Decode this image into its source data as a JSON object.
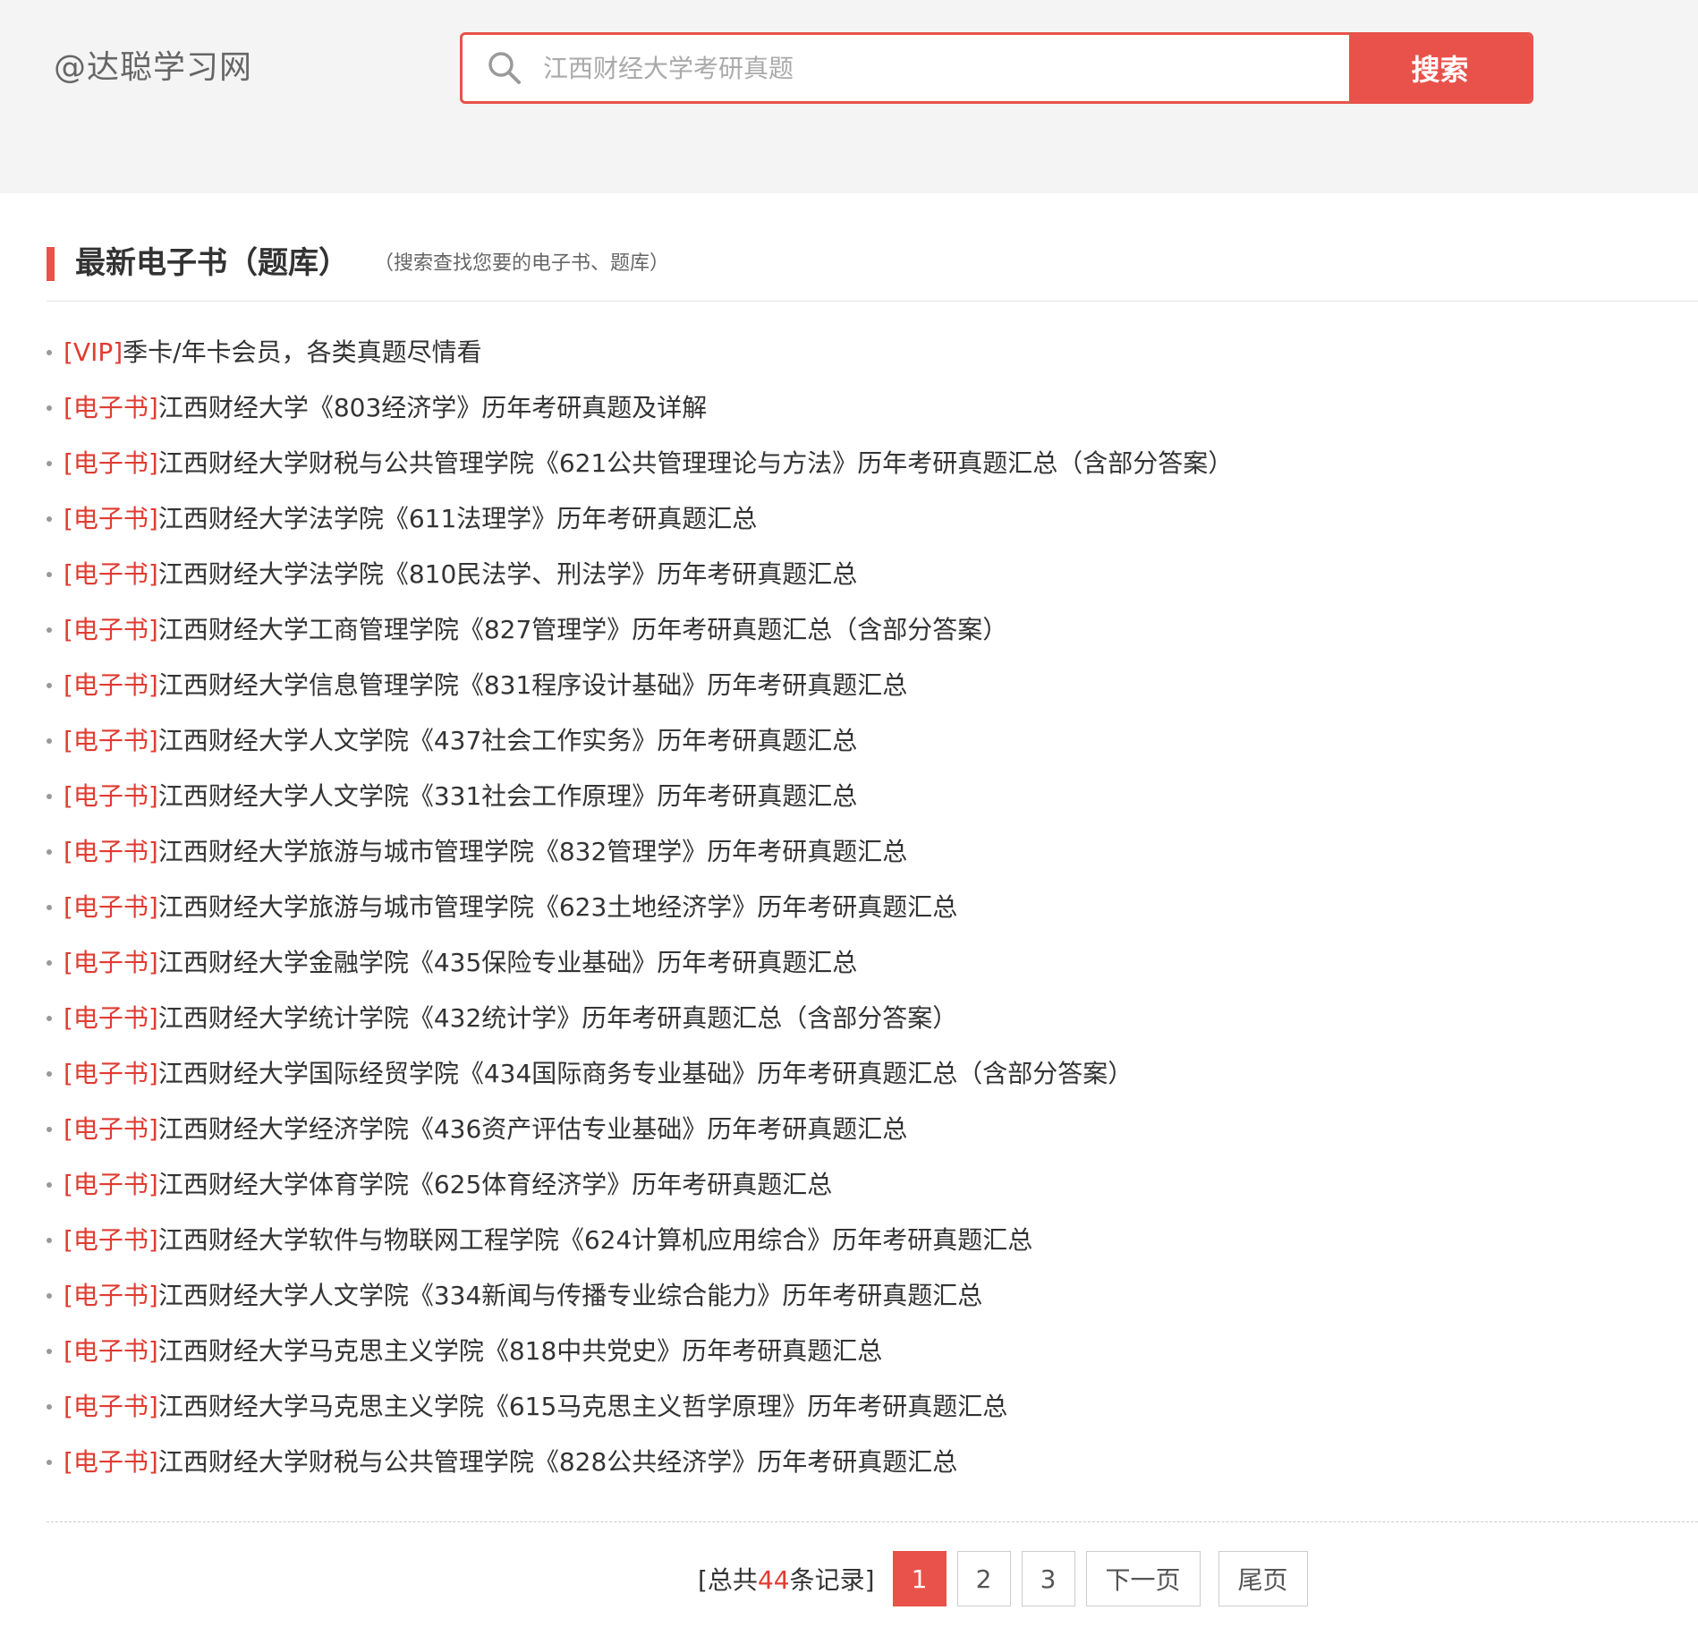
{
  "header": {
    "site_name": "@达聪学习网",
    "search": {
      "placeholder": "江西财经大学考研真题",
      "button_label": "搜索"
    }
  },
  "section": {
    "title": "最新电子书（题库）",
    "subtitle": "（搜索查找您要的电子书、题库）"
  },
  "books": [
    {
      "tag": "[VIP]",
      "title": "季卡/年卡会员，各类真题尽情看"
    },
    {
      "tag": "[电子书]",
      "title": "江西财经大学《803经济学》历年考研真题及详解"
    },
    {
      "tag": "[电子书]",
      "title": "江西财经大学财税与公共管理学院《621公共管理理论与方法》历年考研真题汇总（含部分答案）"
    },
    {
      "tag": "[电子书]",
      "title": "江西财经大学法学院《611法理学》历年考研真题汇总"
    },
    {
      "tag": "[电子书]",
      "title": "江西财经大学法学院《810民法学、刑法学》历年考研真题汇总"
    },
    {
      "tag": "[电子书]",
      "title": "江西财经大学工商管理学院《827管理学》历年考研真题汇总（含部分答案）"
    },
    {
      "tag": "[电子书]",
      "title": "江西财经大学信息管理学院《831程序设计基础》历年考研真题汇总"
    },
    {
      "tag": "[电子书]",
      "title": "江西财经大学人文学院《437社会工作实务》历年考研真题汇总"
    },
    {
      "tag": "[电子书]",
      "title": "江西财经大学人文学院《331社会工作原理》历年考研真题汇总"
    },
    {
      "tag": "[电子书]",
      "title": "江西财经大学旅游与城市管理学院《832管理学》历年考研真题汇总"
    },
    {
      "tag": "[电子书]",
      "title": "江西财经大学旅游与城市管理学院《623土地经济学》历年考研真题汇总"
    },
    {
      "tag": "[电子书]",
      "title": "江西财经大学金融学院《435保险专业基础》历年考研真题汇总"
    },
    {
      "tag": "[电子书]",
      "title": "江西财经大学统计学院《432统计学》历年考研真题汇总（含部分答案）"
    },
    {
      "tag": "[电子书]",
      "title": "江西财经大学国际经贸学院《434国际商务专业基础》历年考研真题汇总（含部分答案）"
    },
    {
      "tag": "[电子书]",
      "title": "江西财经大学经济学院《436资产评估专业基础》历年考研真题汇总"
    },
    {
      "tag": "[电子书]",
      "title": "江西财经大学体育学院《625体育经济学》历年考研真题汇总"
    },
    {
      "tag": "[电子书]",
      "title": "江西财经大学软件与物联网工程学院《624计算机应用综合》历年考研真题汇总"
    },
    {
      "tag": "[电子书]",
      "title": "江西财经大学人文学院《334新闻与传播专业综合能力》历年考研真题汇总"
    },
    {
      "tag": "[电子书]",
      "title": "江西财经大学马克思主义学院《818中共党史》历年考研真题汇总"
    },
    {
      "tag": "[电子书]",
      "title": "江西财经大学马克思主义学院《615马克思主义哲学原理》历年考研真题汇总"
    },
    {
      "tag": "[电子书]",
      "title": "江西财经大学财税与公共管理学院《828公共经济学》历年考研真题汇总"
    }
  ],
  "pagination": {
    "total_prefix": "[总共",
    "total_count": "44",
    "total_suffix": "条记录]",
    "pages": [
      "1",
      "2",
      "3"
    ],
    "current_page": "1",
    "next_label": "下一页",
    "last_label": "尾页"
  },
  "colors": {
    "accent": "#e8524a",
    "tag": "#e03c31",
    "header_bg": "#f4f4f4"
  }
}
